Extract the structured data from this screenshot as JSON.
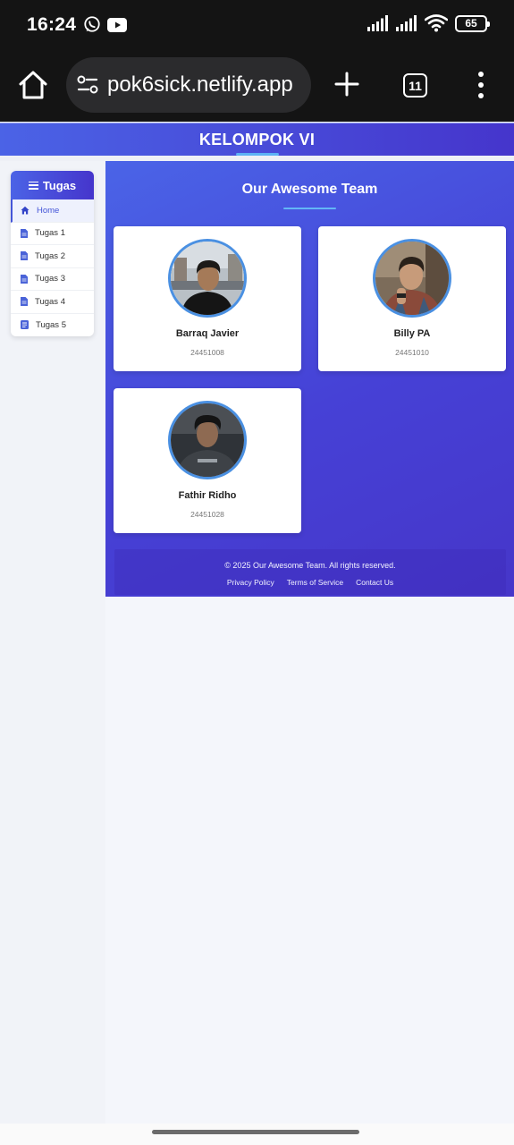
{
  "status_bar": {
    "time": "16:24",
    "app_icons": [
      "whatsapp-icon",
      "youtube-icon"
    ],
    "system_icons": [
      "signal-icon",
      "signal-icon",
      "wifi-icon"
    ],
    "battery": "65"
  },
  "browser": {
    "url": "pok6sick.netlify.app",
    "tab_count": "11",
    "icons": [
      "home-icon",
      "site-settings-icon",
      "plus-icon",
      "tabs-icon",
      "more-icon"
    ]
  },
  "page": {
    "header_title": "KELOMPOK VI",
    "sidebar": {
      "title": "Tugas",
      "items": [
        {
          "label": "Home",
          "icon": "home-icon",
          "active": true
        },
        {
          "label": "Tugas 1",
          "icon": "document-icon"
        },
        {
          "label": "Tugas 2",
          "icon": "document-icon"
        },
        {
          "label": "Tugas 3",
          "icon": "document-icon"
        },
        {
          "label": "Tugas 4",
          "icon": "document-icon"
        },
        {
          "label": "Tugas 5",
          "icon": "document-list-icon"
        }
      ]
    },
    "main": {
      "title": "Our Awesome Team",
      "members": [
        {
          "name": "Barraq Javier",
          "id": "24451008"
        },
        {
          "name": "Billy PA",
          "id": "24451010"
        },
        {
          "name": "Fathir Ridho",
          "id": "24451028"
        }
      ]
    },
    "footer": {
      "copyright": "© 2025 Our Awesome Team. All rights reserved.",
      "links": [
        "Privacy Policy",
        "Terms of Service",
        "Contact Us"
      ]
    }
  },
  "colors": {
    "accent": "#4455d8",
    "header_gradient_start": "#4b63e6",
    "header_gradient_end": "#4535cc",
    "underline": "#5cb2f5",
    "avatar_border": "#4a90e2"
  }
}
